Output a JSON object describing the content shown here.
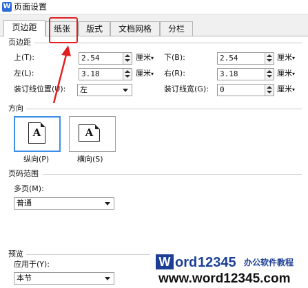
{
  "window": {
    "title": "页面设置",
    "app_icon_letter": "W"
  },
  "tabs": [
    {
      "label": "页边距",
      "active": true
    },
    {
      "label": "纸张",
      "active": false
    },
    {
      "label": "版式",
      "active": false
    },
    {
      "label": "文档网格",
      "active": false
    },
    {
      "label": "分栏",
      "active": false
    }
  ],
  "margins": {
    "heading": "页边距",
    "top": {
      "label": "上(T):",
      "value": "2.54",
      "unit": "厘米"
    },
    "bottom": {
      "label": "下(B):",
      "value": "2.54",
      "unit": "厘米"
    },
    "left": {
      "label": "左(L):",
      "value": "3.18",
      "unit": "厘米"
    },
    "right": {
      "label": "右(R):",
      "value": "3.18",
      "unit": "厘米"
    },
    "gutter_position": {
      "label": "装订线位置(U):",
      "value": "左"
    },
    "gutter_width": {
      "label": "装订线宽(G):",
      "value": "0",
      "unit": "厘米"
    }
  },
  "orientation": {
    "heading": "方向",
    "portrait": {
      "label": "纵向(P)",
      "glyph": "A",
      "selected": true
    },
    "landscape": {
      "label": "横向(S)",
      "glyph": "A",
      "selected": false
    }
  },
  "pages": {
    "heading": "页码范围",
    "multiple_label": "多页(M):",
    "multiple_value": "普通"
  },
  "preview": {
    "heading": "预览",
    "apply_to_label": "应用于(Y):",
    "apply_to_value": "本节"
  },
  "watermark": {
    "brand": "Word12345",
    "brand_w": "W",
    "brand_ord": "ord",
    "brand_num": "12345",
    "slogan": "办公软件教程",
    "url": "www.word12345.com"
  },
  "annotation": {
    "color": "#e02020",
    "target": "纸张"
  },
  "colors": {
    "selected_border": "#3c8ee6",
    "annotation_red": "#e02020",
    "watermark_blue": "#1c3f95"
  }
}
